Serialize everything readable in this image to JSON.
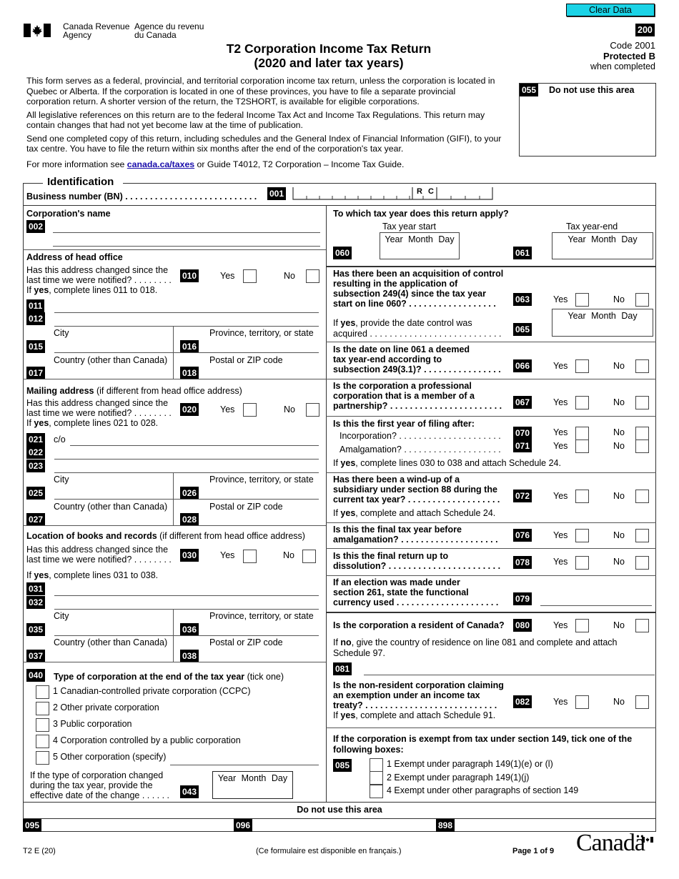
{
  "header": {
    "clear_button": "Clear Data",
    "agency_en_1": "Canada Revenue",
    "agency_en_2": "Agency",
    "agency_fr_1": "Agence du revenu",
    "agency_fr_2": "du Canada",
    "title_1": "T2 Corporation Income Tax Return",
    "title_2": "(2020 and later tax years)",
    "form_code_box": "200",
    "code_text": "Code 2001",
    "protected": "Protected B",
    "when_completed": "when completed"
  },
  "intro": {
    "p1_l1": "This form serves as a federal, provincial, and territorial corporation income tax return, unless the corporation is located in",
    "p1_l2": "Quebec or Alberta. If the corporation is located in one of these provinces, you have to file a separate provincial",
    "p1_l3": "corporation return. A shorter version of the return, the T2SHORT, is available for eligible corporations.",
    "p2_l1": "All legislative references on this return are to the federal Income Tax Act and Income Tax Regulations. This return may",
    "p2_l2": "contain changes that had not yet become law at the time of publication.",
    "p3_l1": "Send one completed copy of this return, including schedules and the General Index of Financial Information (GIFI), to your",
    "p3_l2": "tax centre. You have to file the return within six months after the end of the corporation's tax year.",
    "p4_pre": "For more information see ",
    "p4_link": "canada.ca/taxes",
    "p4_post": " or Guide T4012, T2 Corporation – Income Tax Guide.",
    "do_not_use_code": "055",
    "do_not_use_label": "Do not use this area"
  },
  "identification": {
    "legend": "Identification",
    "bn_label": "Business number (BN) . . . . . . . . . . . . . . . . . . . . . . . . . . .",
    "bn_code": "001",
    "bn_rc": "R",
    "bn_rc2": "C",
    "corp_name_label": "Corporation's name",
    "corp_name_code": "002"
  },
  "head_office": {
    "title": "Address of head office",
    "q_l1": "Has this address changed since the",
    "q_l2": "last time we were notified? . . . . . . . .",
    "code": "010",
    "yes": "Yes",
    "no": "No",
    "note_pre": "If ",
    "note_bold": "yes",
    "note_post": ", complete lines 011 to 018.",
    "codes": [
      "011",
      "012",
      "015",
      "016",
      "017",
      "018"
    ],
    "city": "City",
    "province": "Province, territory, or state",
    "country": "Country (other than Canada)",
    "postal": "Postal or ZIP code"
  },
  "mailing": {
    "title": "Mailing address",
    "title_note": " (if different from head office address)",
    "q_l1": "Has this address changed since the",
    "q_l2": "last time we were notified? . . . . . . . .",
    "code": "020",
    "yes": "Yes",
    "no": "No",
    "note_pre": "If ",
    "note_bold": "yes",
    "note_post": ", complete lines 021 to 028.",
    "co": "c/o",
    "codes": [
      "021",
      "022",
      "023",
      "025",
      "026",
      "027",
      "028"
    ],
    "city": "City",
    "province": "Province, territory, or state",
    "country": "Country (other than Canada)",
    "postal": "Postal or ZIP code"
  },
  "books": {
    "title": "Location of books and records",
    "title_note": " (if different from head office address)",
    "q_l1": "Has this address changed since the",
    "q_l2": "last time we were notified? . . . . . . . .",
    "code": "030",
    "yes": "Yes",
    "no": "No",
    "note_pre": "If ",
    "note_bold": "yes",
    "note_post": ", complete lines 031 to 038.",
    "codes": [
      "031",
      "032",
      "035",
      "036",
      "037",
      "038"
    ],
    "city": "City",
    "province": "Province, territory, or state",
    "country": "Country (other than Canada)",
    "postal": "Postal or ZIP code"
  },
  "corp_type": {
    "code": "040",
    "title": "Type of corporation at the end of the tax year",
    "title_note": " (tick one)",
    "options": [
      "1 Canadian-controlled private corporation (CCPC)",
      "2 Other private corporation",
      "3 Public corporation",
      "4 Corporation controlled by a public corporation",
      "5 Other corporation (specify)"
    ],
    "change_l1": "If the type of corporation changed",
    "change_l2": "during the tax year, provide the",
    "change_l3": "effective date of the change  . . . . . .",
    "change_code": "043",
    "date_label": "Year  Month  Day"
  },
  "tax_year": {
    "question": "To which tax year does this return apply?",
    "start_label": "Tax year start",
    "end_label": "Tax year-end",
    "start_code": "060",
    "end_code": "061",
    "date_label": "Year  Month  Day"
  },
  "right_questions": {
    "acq_l1": "Has there been an acquisition of control",
    "acq_l2": "resulting in the application of",
    "acq_l3": "subsection 249(4) since the tax year",
    "acq_l4": "start on line 060? . . . . . . . . . . . . . . . . . .",
    "acq_code": "063",
    "acq_date_l1": "If ",
    "acq_date_bold": "yes",
    "acq_date_l1b": ", provide the date control was",
    "acq_date_l2": "acquired . . . . . . . . . . . . . . . . . . . . . . . . . . .",
    "acq_date_code": "065",
    "date_label": "Year  Month  Day",
    "deemed_l1": "Is the date on line 061 a deemed",
    "deemed_l2": "tax year-end according to",
    "deemed_l3": "subsection 249(3.1)? . . . . . . . . . . . . . . . .",
    "deemed_code": "066",
    "prof_l1": "Is the corporation a professional",
    "prof_l2": "corporation that is a member of a",
    "prof_l3": "partnership? . . . . . . . . . . . . . . . . . . . . . . .",
    "prof_code": "067",
    "first_title": "Is this the first year of filing after:",
    "incorp": "Incorporation? . . . . . . . . . . . . . . . . . . . . .",
    "incorp_code": "070",
    "amalg": "Amalgamation? . . . . . . . . . . . . . . . . . . . .",
    "amalg_code": "071",
    "first_note_pre": "If ",
    "first_note_bold": "yes",
    "first_note_post": ", complete lines 030 to 038 and attach Schedule 24.",
    "wind_l1": "Has there been a wind-up of a",
    "wind_l2": "subsidiary under section 88 during the",
    "wind_l3": "current tax year? . . . . . . . . . . . . . . . . . . .",
    "wind_code": "072",
    "wind_note_pre": "If ",
    "wind_note_bold": "yes",
    "wind_note_post": ", complete and attach Schedule 24.",
    "final_amalg_l1": "Is this the final tax year before",
    "final_amalg_l2": "amalgamation?  . . . . . . . . . . . . . . . . . . . .",
    "final_amalg_code": "076",
    "final_diss_l1": "Is this the final return up to",
    "final_diss_l2": "dissolution? . . . . . . . . . . . . . . . . . . . . . . .",
    "final_diss_code": "078",
    "elect_l1": "If an election was made under",
    "elect_l2": "section 261, state the functional",
    "elect_l3": "currency used  . . . . . . . . . . . . . . . . . . . . .",
    "elect_code": "079",
    "resident_q": "Is the corporation a resident of Canada?",
    "resident_code": "080",
    "resident_note_pre": "If ",
    "resident_note_bold": "no",
    "resident_note_post": ", give the country of residence on line 081 and complete and attach",
    "resident_note_l2": "Schedule 97.",
    "country_code": "081",
    "nonres_l1": "Is the non-resident corporation claiming",
    "nonres_l2": "an exemption under an income tax",
    "nonres_l3": "treaty? . . . . . . . . . . . . . . . . . . . . . . . . . . .",
    "nonres_code": "082",
    "nonres_note_pre": "If ",
    "nonres_note_bold": "yes",
    "nonres_note_post": ", complete and attach Schedule 91.",
    "exempt_l1": "If the corporation is exempt from tax under section 149, tick one of the",
    "exempt_l2": "following boxes:",
    "exempt_code": "085",
    "exempt_options": [
      "1  Exempt under paragraph 149(1)(e) or (l)",
      "2  Exempt under paragraph 149(1)(j)",
      "4  Exempt under other paragraphs of section 149"
    ],
    "yes": "Yes",
    "no": "No"
  },
  "bottom": {
    "do_not_use": "Do not use this area",
    "codes": [
      "095",
      "096",
      "898"
    ]
  },
  "footer": {
    "form_id": "T2 E (20)",
    "french": "(Ce formulaire est disponible en français.)",
    "page": "Page 1 of 9",
    "wordmark": "Canadä"
  }
}
